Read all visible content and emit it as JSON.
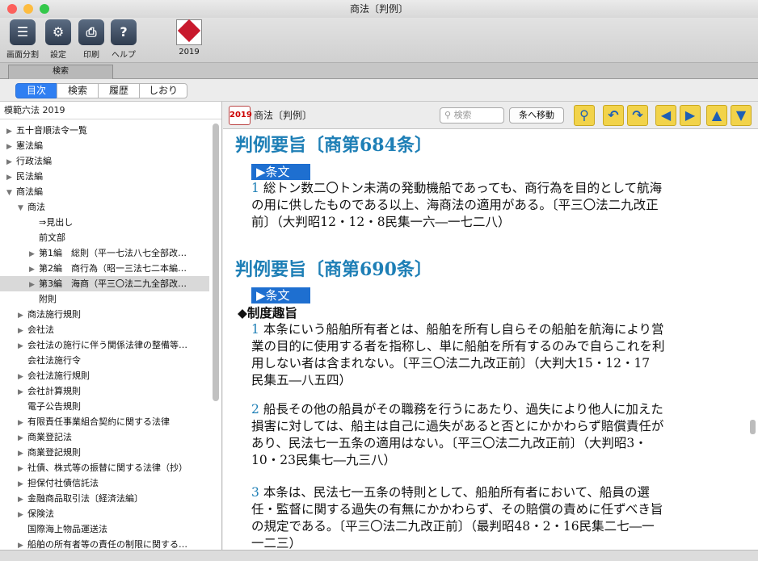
{
  "window": {
    "title": "商法〔判例〕"
  },
  "toolbar": {
    "buttons": [
      {
        "label": "画面分割",
        "icon": "split-view-icon"
      },
      {
        "label": "設定",
        "icon": "gear-icon"
      },
      {
        "label": "印刷",
        "icon": "printer-icon"
      },
      {
        "label": "ヘルプ",
        "icon": "help-icon"
      }
    ],
    "book": {
      "label": "2019",
      "icon": "roppo-book-icon"
    }
  },
  "search_tab": "検索",
  "segments": [
    "目次",
    "検索",
    "履歴",
    "しおり"
  ],
  "sidebar": {
    "header": "模範六法 2019",
    "items": [
      {
        "label": "五十音順法令一覧",
        "arrow": "▶",
        "indent": 0
      },
      {
        "label": "憲法編",
        "arrow": "▶",
        "indent": 0
      },
      {
        "label": "行政法編",
        "arrow": "▶",
        "indent": 0
      },
      {
        "label": "民法編",
        "arrow": "▶",
        "indent": 0
      },
      {
        "label": "商法編",
        "arrow": "▼",
        "indent": 0
      },
      {
        "label": "商法",
        "arrow": "▼",
        "indent": 1
      },
      {
        "label": "⇒見出し",
        "arrow": "",
        "indent": 2
      },
      {
        "label": "前文部",
        "arrow": "",
        "indent": 2
      },
      {
        "label": "第1編　総則（平一七法八七全部改…",
        "arrow": "▶",
        "indent": 2
      },
      {
        "label": "第2編　商行為（昭一三法七二本編…",
        "arrow": "▶",
        "indent": 2
      },
      {
        "label": "第3編　海商（平三〇法二九全部改…",
        "arrow": "▶",
        "indent": 2,
        "selected": true
      },
      {
        "label": "附則",
        "arrow": "",
        "indent": 2
      },
      {
        "label": "商法施行規則",
        "arrow": "▶",
        "indent": 1
      },
      {
        "label": "会社法",
        "arrow": "▶",
        "indent": 1
      },
      {
        "label": "会社法の施行に伴う関係法律の整備等…",
        "arrow": "▶",
        "indent": 1
      },
      {
        "label": "会社法施行令",
        "arrow": "",
        "indent": 1
      },
      {
        "label": "会社法施行規則",
        "arrow": "▶",
        "indent": 1
      },
      {
        "label": "会社計算規則",
        "arrow": "▶",
        "indent": 1
      },
      {
        "label": "電子公告規則",
        "arrow": "",
        "indent": 1
      },
      {
        "label": "有限責任事業組合契約に関する法律",
        "arrow": "▶",
        "indent": 1
      },
      {
        "label": "商業登記法",
        "arrow": "▶",
        "indent": 1
      },
      {
        "label": "商業登記規則",
        "arrow": "▶",
        "indent": 1
      },
      {
        "label": "社債、株式等の振替に関する法律（抄）",
        "arrow": "▶",
        "indent": 1
      },
      {
        "label": "担保付社債信託法",
        "arrow": "▶",
        "indent": 1
      },
      {
        "label": "金融商品取引法〔経済法編〕",
        "arrow": "▶",
        "indent": 1
      },
      {
        "label": "保険法",
        "arrow": "▶",
        "indent": 1
      },
      {
        "label": "国際海上物品運送法",
        "arrow": "",
        "indent": 1
      },
      {
        "label": "船舶の所有者等の責任の制限に関する…",
        "arrow": "▶",
        "indent": 1
      }
    ]
  },
  "content_header": {
    "badge": "2019",
    "title": "商法〔判例〕",
    "search_placeholder": "検索",
    "jump_label": "条へ移動",
    "nav": [
      {
        "glyph": "⚲",
        "icon": "search-icon"
      },
      {
        "glyph": "↶",
        "icon": "back-icon"
      },
      {
        "glyph": "↷",
        "icon": "forward-icon"
      },
      {
        "glyph": "◀",
        "icon": "previous-icon"
      },
      {
        "glyph": "▶",
        "icon": "next-icon"
      },
      {
        "glyph": "▲",
        "icon": "up-icon"
      },
      {
        "glyph": "▼",
        "icon": "down-icon"
      }
    ]
  },
  "content": {
    "heading1": "判例要旨〔商第684条〕",
    "jobun": "▶条文",
    "p1_num": "1",
    "p1_lines": [
      "総トン数二〇トン未満の発動機船であっても、商行為を目的として航海",
      "の用に供したものである以上、海商法の適用がある。〔平三〇法二九改正",
      "前〕（大判昭12・12・8民集一六―一七二八）"
    ],
    "heading2": "判例要旨〔商第690条〕",
    "subhead": "◆制度趣旨",
    "p2_num": "1",
    "p2_lines": [
      "本条にいう船舶所有者とは、船舶を所有し自らその船舶を航海により営",
      "業の目的に使用する者を指称し、単に船舶を所有するのみで自らこれを利",
      "用しない者は含まれない。〔平三〇法二九改正前〕（大判大15・12・17",
      "民集五―八五四）"
    ],
    "p3_num": "2",
    "p3_lines": [
      "船長その他の船員がその職務を行うにあたり、過失により他人に加えた",
      "損害に対しては、船主は自己に過失があると否とにかかわらず賠償責任が",
      "あり、民法七一五条の適用はない。〔平三〇法二九改正前〕（大判昭3・",
      "10・23民集七―九三八）"
    ],
    "p4_num": "3",
    "p4_lines": [
      "本条は、民法七一五条の特則として、船舶所有者において、船員の選",
      "任・監督に関する過失の有無にかかわらず、その賠償の責めに任ずべき旨",
      "の規定である。〔平三〇法二九改正前〕（最判昭48・2・16民集二七―一",
      "一二三）"
    ]
  }
}
